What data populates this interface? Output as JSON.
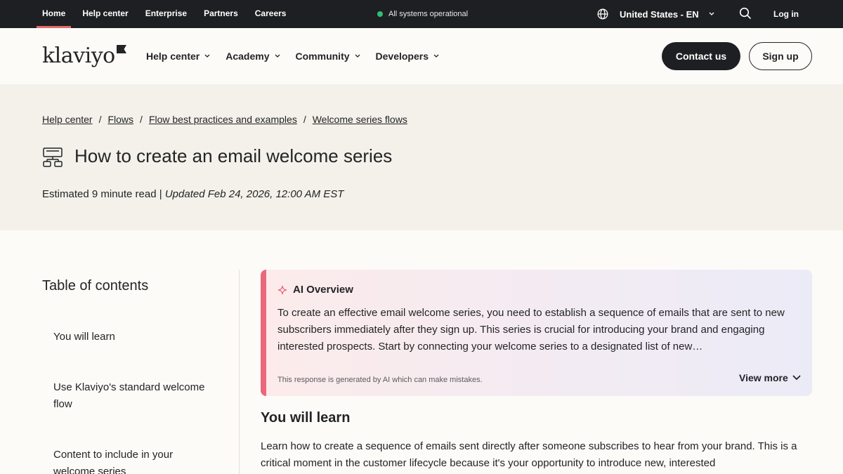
{
  "utility_bar": {
    "links": [
      "Home",
      "Help center",
      "Enterprise",
      "Partners",
      "Careers"
    ],
    "status_text": "All systems operational",
    "locale": "United States - EN",
    "login": "Log in"
  },
  "header": {
    "logo": "klaviyo",
    "nav": [
      "Help center",
      "Academy",
      "Community",
      "Developers"
    ],
    "contact_button": "Contact us",
    "signup_button": "Sign up"
  },
  "breadcrumb": {
    "items": [
      "Help center",
      "Flows",
      "Flow best practices and examples",
      "Welcome series flows"
    ],
    "separator": "/"
  },
  "article": {
    "title": "How to create an email welcome series",
    "read_time": "Estimated 9 minute read",
    "meta_separator": "|",
    "updated": "Updated Feb 24, 2026, 12:00 AM EST"
  },
  "toc": {
    "title": "Table of contents",
    "items": [
      "You will learn",
      "Use Klaviyo's standard welcome flow",
      "Content to include in your welcome series"
    ]
  },
  "ai_overview": {
    "title": "AI Overview",
    "body": "To create an effective email welcome series, you need to establish a sequence of emails that are sent to new subscribers immediately after they sign up. This series is crucial for introducing your brand and engaging interested prospects. Start by connecting your welcome series to a designated list of new…",
    "disclaimer": "This response is generated by AI which can make mistakes.",
    "view_more": "View more"
  },
  "section": {
    "title": "You will learn",
    "body": "Learn how to create a sequence of emails sent directly after someone subscribes to hear from your brand. This is a critical moment in the customer lifecycle because it's your opportunity to introduce new, interested"
  },
  "icons": {
    "globe": "globe-icon",
    "search": "search-icon",
    "chevron": "chevron-down-icon",
    "flow": "flow-diagram-icon",
    "sparkle": "sparkle-icon"
  },
  "colors": {
    "utility_bg": "#1e1f22",
    "hero_bg": "#f3f1ea",
    "accent": "#e9687a",
    "status_green": "#2fbf71"
  }
}
